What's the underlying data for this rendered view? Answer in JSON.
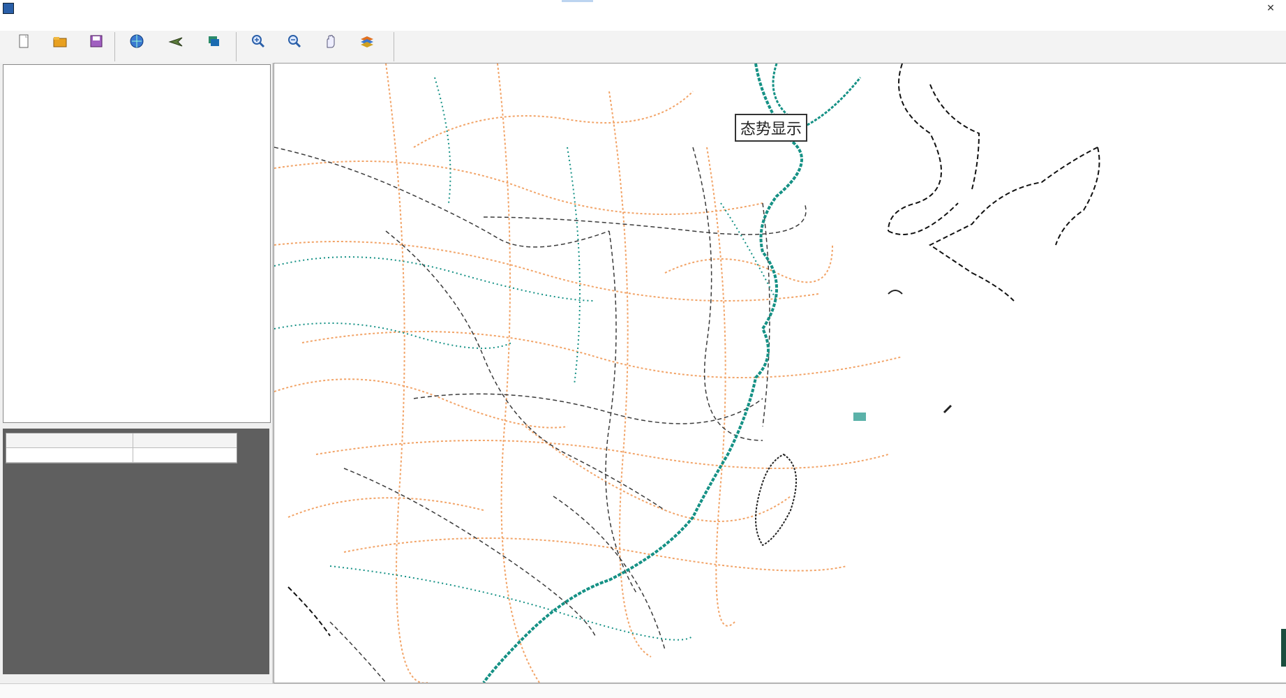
{
  "window": {
    "title": "",
    "buttons": {
      "minimize": "",
      "close": "✕"
    }
  },
  "menu": {
    "items": [
      "",
      "",
      "",
      "",
      ""
    ]
  },
  "toolbar": {
    "buttons": [
      {
        "id": "new",
        "label": "",
        "icon": "new-file-icon"
      },
      {
        "id": "open",
        "label": "",
        "icon": "open-folder-icon"
      },
      {
        "id": "save",
        "label": "",
        "icon": "save-icon"
      },
      {
        "id": "globe",
        "label": "",
        "icon": "globe-icon"
      },
      {
        "id": "plane",
        "label": "",
        "icon": "plane-icon"
      },
      {
        "id": "stack",
        "label": "",
        "icon": "layers-icon"
      },
      {
        "id": "zoomin",
        "label": "",
        "icon": "zoom-in-icon"
      },
      {
        "id": "zoomout",
        "label": "",
        "icon": "zoom-out-icon"
      },
      {
        "id": "pan",
        "label": "",
        "icon": "hand-icon"
      },
      {
        "id": "layers",
        "label": "",
        "icon": "map-layers-icon"
      }
    ]
  },
  "tree": {
    "items": [
      "",
      "",
      "",
      "",
      ""
    ]
  },
  "grid": {
    "headers": [
      "",
      ""
    ],
    "rows": [
      [
        "",
        ""
      ]
    ]
  },
  "map": {
    "overlay_label": "态势显示",
    "cities": [
      {
        "name": "",
        "x": 0,
        "y": 0
      }
    ],
    "colors": {
      "road": "#f2a468",
      "rail": "#3b3b3b",
      "water": "#159185",
      "border": "#111111",
      "label": "#4d7a12",
      "city": "#7a1010"
    }
  },
  "status": {
    "text": ""
  }
}
